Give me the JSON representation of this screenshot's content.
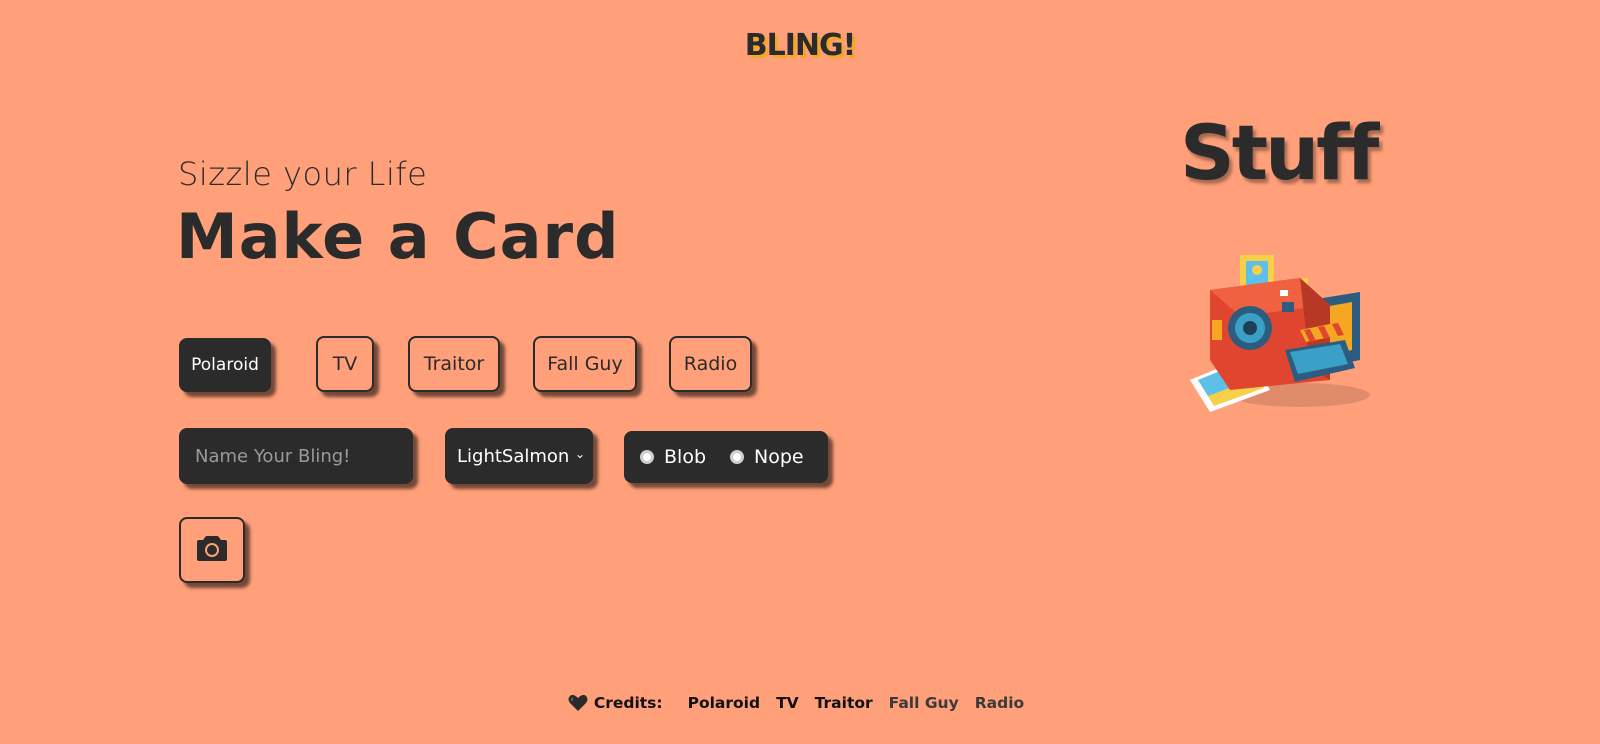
{
  "header": {
    "logo": "BLING!"
  },
  "hero": {
    "subtitle": "Sizzle your Life",
    "title": "Make a Card"
  },
  "presets": [
    {
      "label": "Polaroid",
      "active": true
    },
    {
      "label": "TV",
      "active": false
    },
    {
      "label": "Traitor",
      "active": false
    },
    {
      "label": "Fall Guy",
      "active": false
    },
    {
      "label": "Radio",
      "active": false
    }
  ],
  "form": {
    "name_placeholder": "Name Your Bling!",
    "name_value": "",
    "color_select_value": "LightSalmon",
    "radio_options": [
      {
        "label": "Blob",
        "checked": false
      },
      {
        "label": "Nope",
        "checked": false
      }
    ],
    "camera_icon": "camera-icon"
  },
  "preview": {
    "title": "Stuff",
    "illustration_icon": "polaroid-camera-illustration"
  },
  "credits": {
    "icon": "heart-icon",
    "label": "Credits:",
    "links": [
      "Polaroid",
      "TV",
      "Traitor",
      "Fall Guy",
      "Radio"
    ]
  },
  "colors": {
    "background": "#FFA07A",
    "dark": "#2b2b2b",
    "logo_shadow": "#f5a623"
  }
}
